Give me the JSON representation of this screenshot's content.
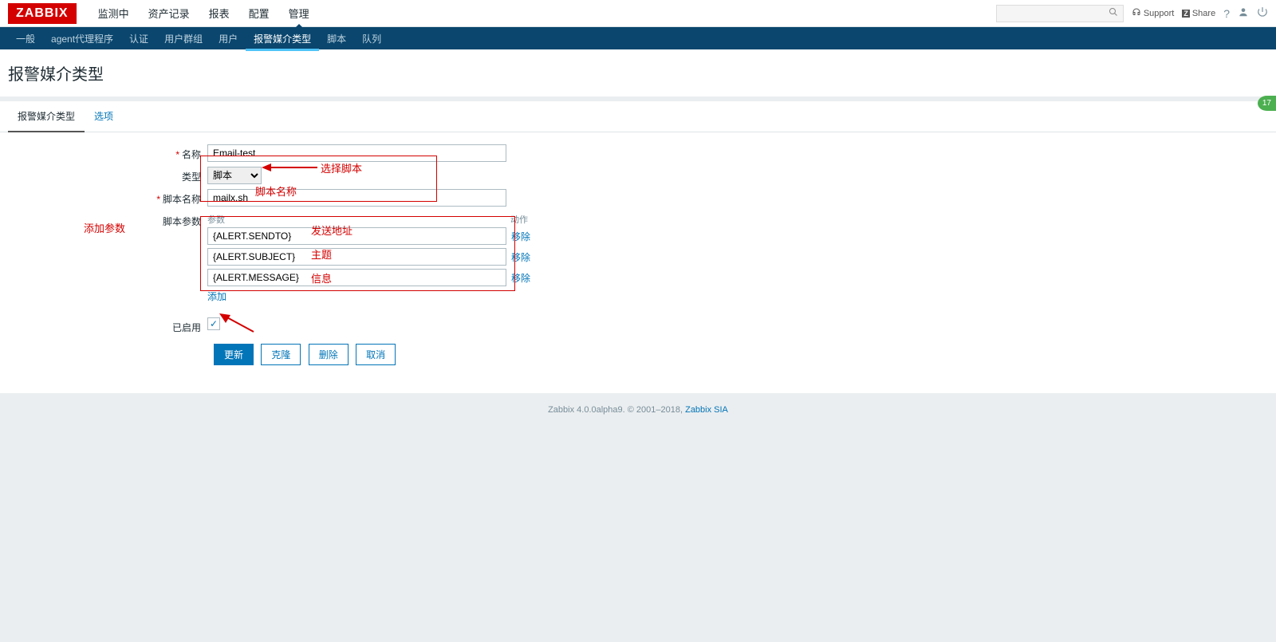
{
  "logo": "ZABBIX",
  "main_nav": {
    "items": [
      "监测中",
      "资产记录",
      "报表",
      "配置",
      "管理"
    ],
    "active": 4
  },
  "top_right": {
    "support": "Support",
    "share": "Share"
  },
  "sub_nav": {
    "items": [
      "一般",
      "agent代理程序",
      "认证",
      "用户群组",
      "用户",
      "报警媒介类型",
      "脚本",
      "队列"
    ],
    "active": 5
  },
  "page_title": "报警媒介类型",
  "tabs": {
    "items": [
      "报警媒介类型",
      "选项"
    ],
    "active": 0
  },
  "form": {
    "name_label": "名称",
    "name_value": "Email-test",
    "type_label": "类型",
    "type_value": "脚本",
    "script_name_label": "脚本名称",
    "script_name_value": "mailx.sh",
    "params_label": "脚本参数",
    "params_head_param": "参数",
    "params_head_action": "动作",
    "params": [
      {
        "value": "{ALERT.SENDTO}"
      },
      {
        "value": "{ALERT.SUBJECT}"
      },
      {
        "value": "{ALERT.MESSAGE}"
      }
    ],
    "remove_text": "移除",
    "add_text": "添加",
    "enabled_label": "已启用"
  },
  "buttons": {
    "update": "更新",
    "clone": "克隆",
    "delete": "删除",
    "cancel": "取消"
  },
  "annotations": {
    "select_script": "选择脚本",
    "script_name": "脚本名称",
    "add_params": "添加参数",
    "send_addr": "发送地址",
    "subject": "主题",
    "message": "信息"
  },
  "footer": {
    "text": "Zabbix 4.0.0alpha9. © 2001–2018, ",
    "link": "Zabbix SIA"
  },
  "badge": "17"
}
